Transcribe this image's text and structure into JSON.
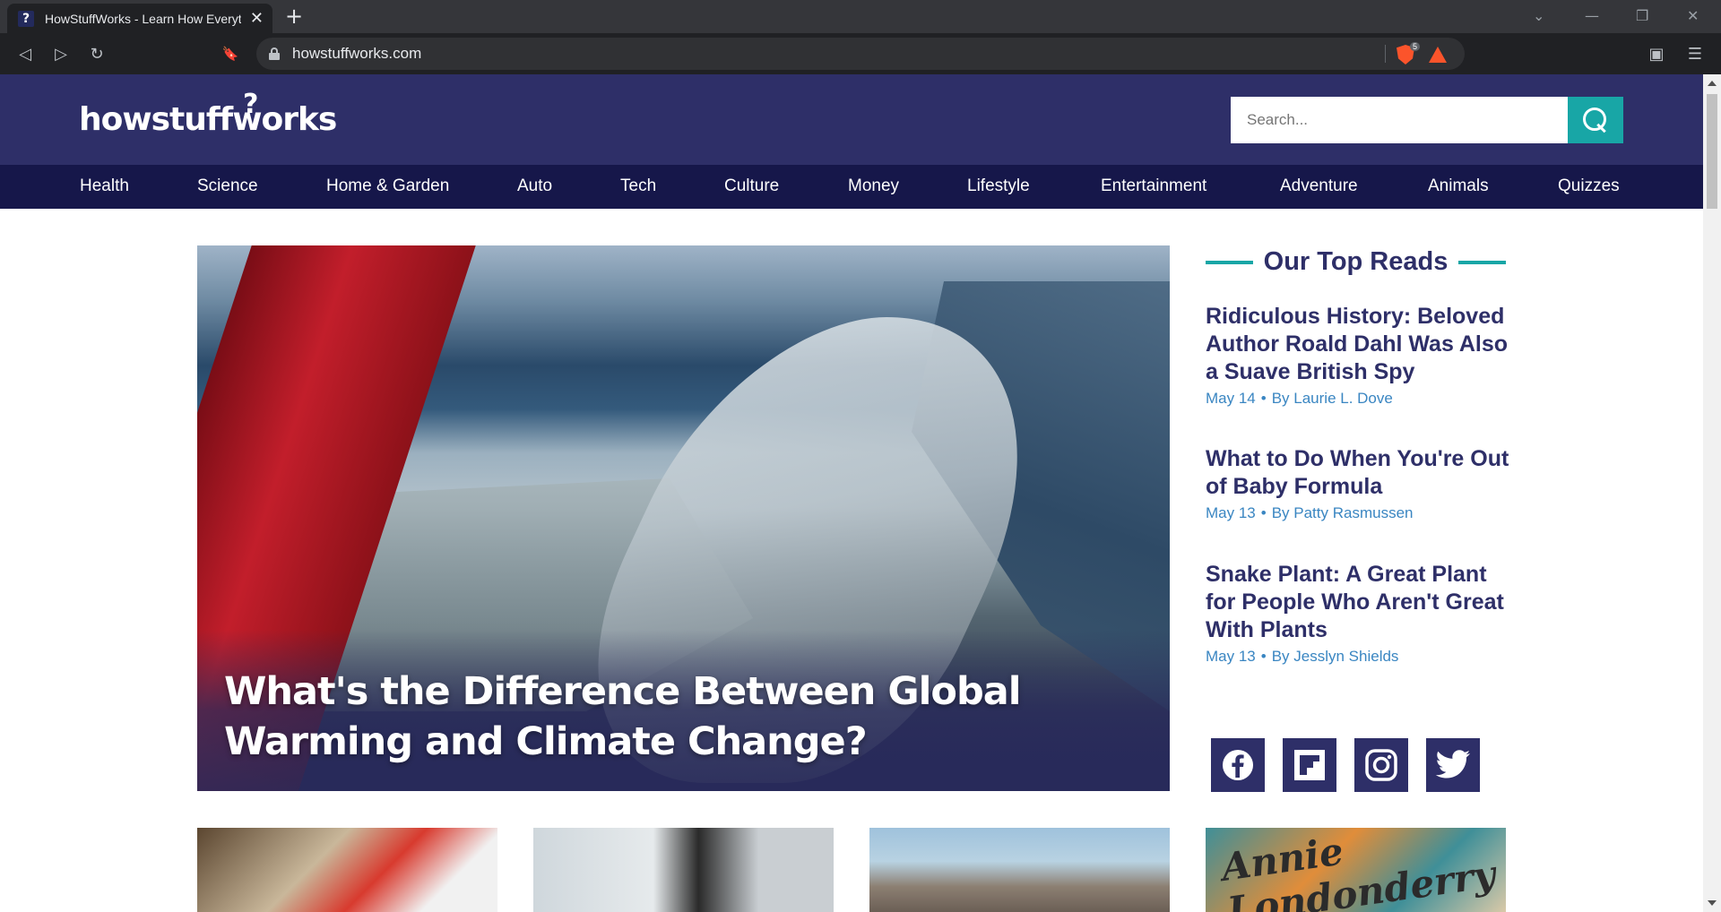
{
  "browser": {
    "tab_title": "HowStuffWorks - Learn How Everything Works!",
    "tab_favicon": "?",
    "tab_close": "✕",
    "new_tab": "+",
    "url": "howstuffworks.com",
    "brave_badge": "5",
    "win_minimize": "—",
    "win_restore": "❐",
    "win_close": "✕",
    "win_dropdown": "⌄"
  },
  "toolbar": {
    "back": "◁",
    "forward": "▷",
    "reload": "↻",
    "bookmark": "🔖",
    "wallet": "▣",
    "menu": "☰"
  },
  "site": {
    "logo_text": "howstuffworks",
    "logo_mark": "?",
    "search_placeholder": "Search...",
    "nav": [
      "Health",
      "Science",
      "Home & Garden",
      "Auto",
      "Tech",
      "Culture",
      "Money",
      "Lifestyle",
      "Entertainment",
      "Adventure",
      "Animals",
      "Quizzes"
    ]
  },
  "hero": {
    "title": "What's the Difference Between Global Warming and Climate Change?"
  },
  "top_reads": {
    "heading": "Our Top Reads",
    "items": [
      {
        "title": "Ridiculous History: Beloved Author Roald Dahl Was Also a Suave British Spy",
        "date": "May 14",
        "author": "By Laurie L. Dove"
      },
      {
        "title": "What to Do When You're Out of Baby Formula",
        "date": "May 13",
        "author": "By Patty Rasmussen"
      },
      {
        "title": "Snake Plant: A Great Plant for People Who Aren't Great With Plants",
        "date": "May 13",
        "author": "By Jesslyn Shields"
      }
    ],
    "separator": "•"
  },
  "thumbs": {
    "fourth_text": "Annie Londonderry"
  },
  "colors": {
    "header_bg": "#2e2f68",
    "nav_bg": "#16174a",
    "accent": "#18a6a6",
    "link_meta": "#3a86c2"
  }
}
